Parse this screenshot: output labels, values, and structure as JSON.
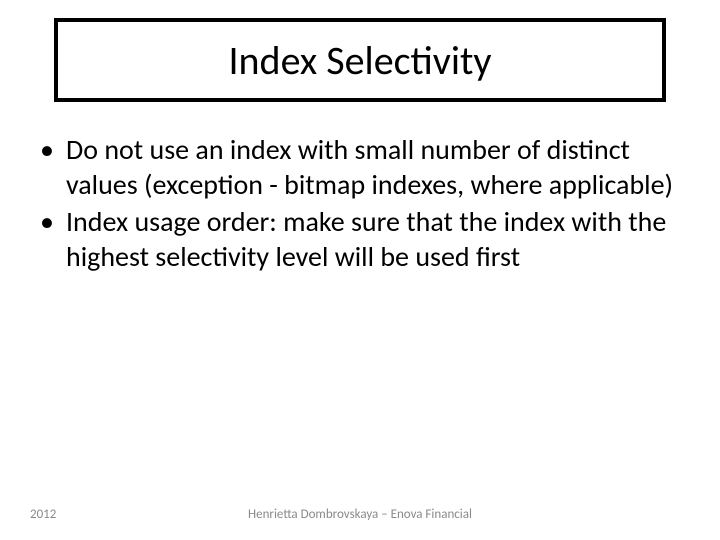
{
  "slide": {
    "title": "Index Selectivity",
    "bullets": [
      "Do not use an index with small number of distinct values (exception - bitmap indexes, where applicable)",
      "Index usage order: make sure that the index with the highest selectivity level will be used first"
    ],
    "footer": {
      "year": "2012",
      "author": "Henrietta Dombrovskaya – Enova Financial"
    }
  }
}
